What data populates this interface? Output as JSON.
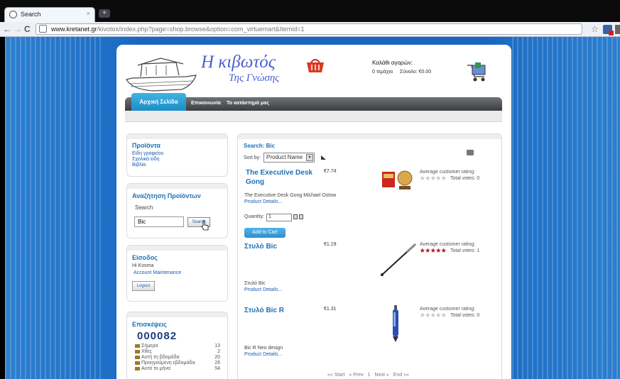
{
  "browser": {
    "tab_title": "Search",
    "tab_close": "×",
    "new_tab": "+",
    "url_host": "www.kretanet.gr",
    "url_path": "/kivotos/index.php?page=shop.browse&option=com_virtuemart&Itemid=1"
  },
  "site": {
    "name": "Η κιβωτός",
    "tagline": "Της Γνώσης",
    "welcome": "Καλάθι αγορών:",
    "cart_items": "0 τεμάχια",
    "cart_total": "Σύνολο: €0.00"
  },
  "menu": [
    "Αρχική Σελίδα",
    "Επικοινωνία",
    "Το κατάστημά μας"
  ],
  "sidebar": {
    "products_title": "Προϊόντα",
    "product_links": [
      "Είδη γραφείου",
      "Σχολικά είδη",
      "Βιβλία"
    ],
    "search_title": "Αναζήτηση Προϊόντων",
    "search_label": "Search",
    "search_value": "Bic",
    "search_button": "Search",
    "login_title": "Είσοδος",
    "login_greeting": "Hi Kosma",
    "account_link": "Account Maintenance",
    "logout_button": "Logout",
    "visits_title": "Επισκέψεις",
    "visits_counter": "000082",
    "stats": [
      {
        "label": "Σήμερα",
        "value": "13"
      },
      {
        "label": "Χθες",
        "value": "2"
      },
      {
        "label": "Αυτή τη βδομάδα",
        "value": "20"
      },
      {
        "label": "Προηγούμενη εβδομάδα",
        "value": "26"
      },
      {
        "label": "Αυτό το μήνα",
        "value": "54"
      }
    ]
  },
  "main": {
    "search_heading": "Search: Bic",
    "sort_label": "Sort by:",
    "sort_value": "Product Name",
    "rating_label": "Average customer rating:",
    "details_link": "Product Details...",
    "quantity_label": "Quantity:",
    "quantity_value": "1",
    "add_to_cart": "Add to Cart",
    "products": [
      {
        "name": "The Executive Desk Gong",
        "price": "€7.74",
        "desc": "The Executive Desk Gong Michael Ostow",
        "votes": "Total votes: 0",
        "rating": 0
      },
      {
        "name": "Στυλό Bic",
        "price": "€1.19",
        "desc": "Στυλό Bic",
        "votes": "Total votes: 1",
        "rating": 5
      },
      {
        "name": "Στυλό Bic R",
        "price": "€1.31",
        "desc": "Bic R Neo design",
        "votes": "Total votes: 0",
        "rating": 0
      }
    ],
    "pagination": [
      "«« Start",
      "« Prev",
      "1",
      "Next »",
      "End »»"
    ]
  },
  "colors": {
    "accent": "#1e6fb5",
    "background": "#1666c2",
    "star_filled": "#b0202a",
    "star_empty": "#c8c8c8"
  }
}
